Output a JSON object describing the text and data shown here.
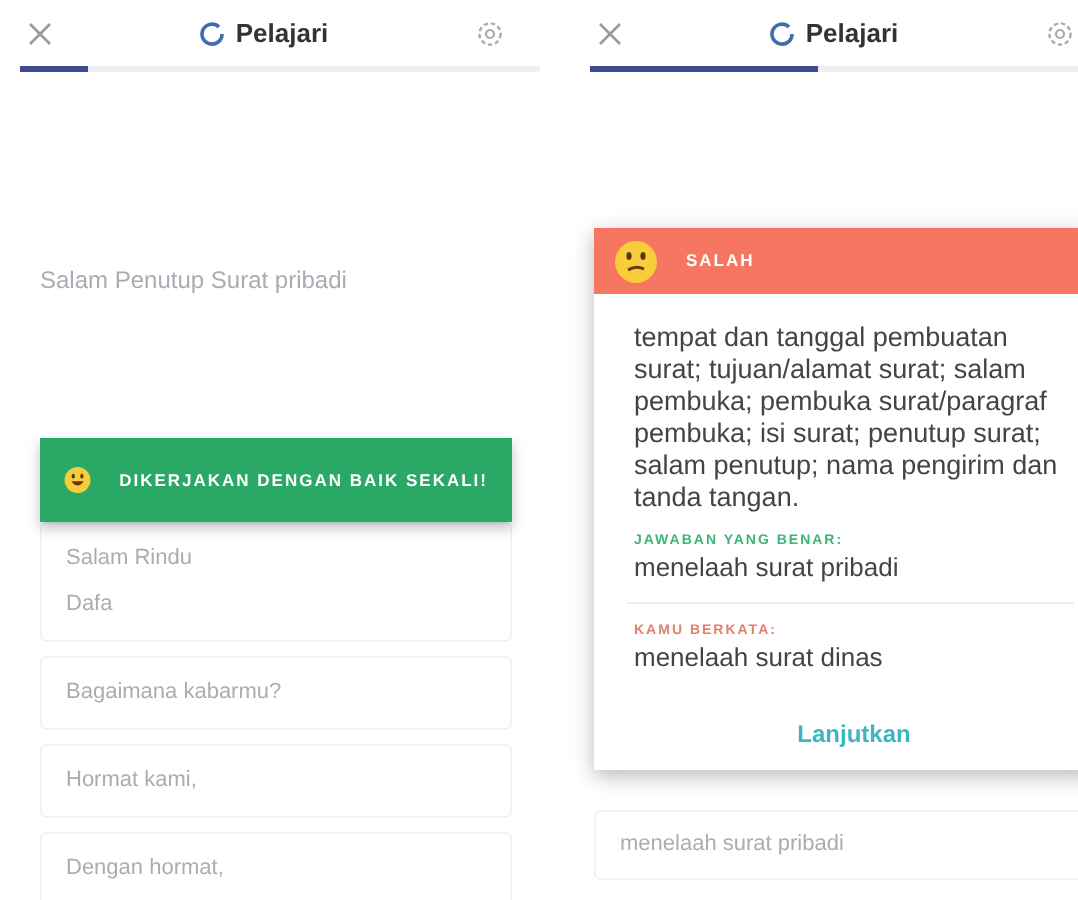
{
  "screens": [
    {
      "header": {
        "title": "Pelajari"
      },
      "progress": {
        "level": 0.13
      },
      "question": "Salam Penutup Surat pribadi",
      "feedback": {
        "kind": "correct",
        "message": "DIKERJAKAN DENGAN BAIK SEKALI!"
      },
      "options": [
        {
          "lines": [
            "Salam Rindu",
            "Dafa"
          ]
        },
        {
          "lines": [
            "Bagaimana kabarmu?"
          ]
        },
        {
          "lines": [
            "Hormat kami,"
          ]
        },
        {
          "lines": [
            "Dengan hormat,"
          ]
        }
      ]
    },
    {
      "header": {
        "title": "Pelajari"
      },
      "progress": {
        "level": 0.44
      },
      "feedback": {
        "kind": "wrong",
        "message": "SALAH",
        "explanation": "tempat dan tanggal pembuatan surat; tujuan/alamat surat; salam pembuka; pembuka surat/paragraf pembuka; isi surat; penutup surat; salam penutup; nama pengirim dan tanda tangan.",
        "correct_label": "JAWABAN YANG BENAR:",
        "correct_answer": "menelaah surat pribadi",
        "your_label": "KAMU BERKATA:",
        "your_answer": "menelaah surat dinas",
        "button": "Lanjutkan"
      },
      "options": [
        {
          "lines": [
            "menelaah surat pribadi"
          ]
        }
      ]
    }
  ]
}
